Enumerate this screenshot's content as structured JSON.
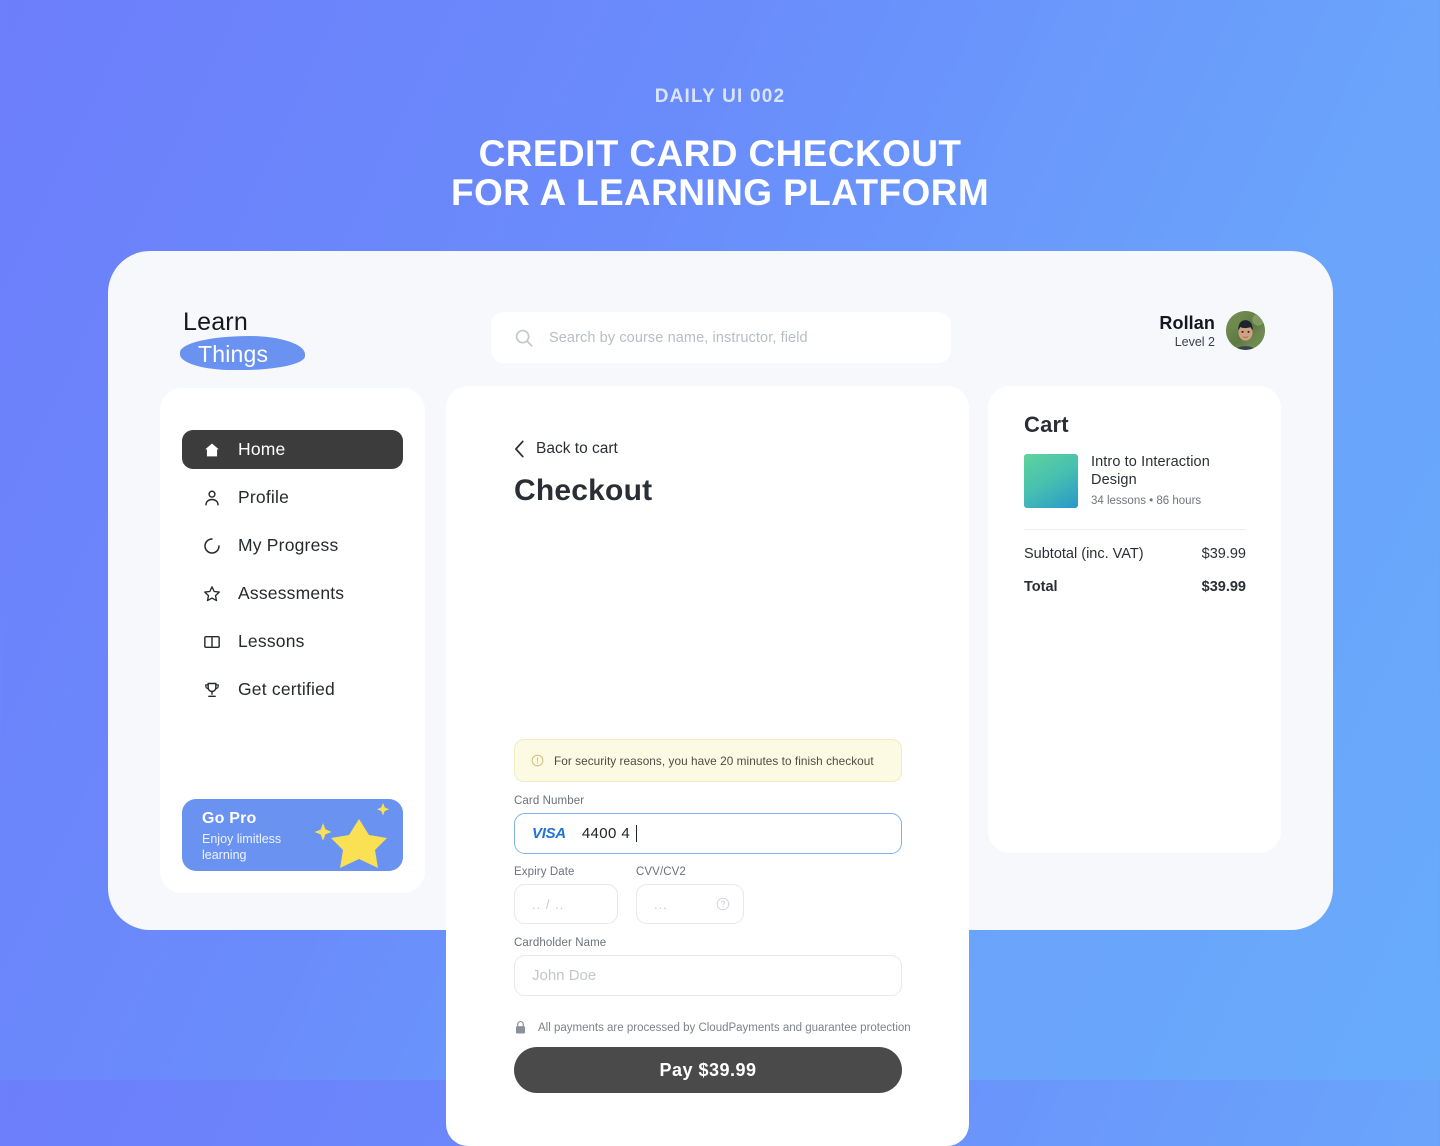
{
  "header": {
    "eyebrow": "DAILY UI 002",
    "title_line1": "CREDIT CARD CHECKOUT",
    "title_line2": "FOR A LEARNING PLATFORM"
  },
  "topbar": {
    "logo_line1": "Learn",
    "logo_line2": "Things",
    "search": {
      "placeholder": "Search by course name, instructor, field",
      "value": ""
    },
    "user": {
      "name": "Rollan",
      "level": "Level 2"
    }
  },
  "sidebar": {
    "items": [
      {
        "label": "Home",
        "icon": "home-icon",
        "active": true
      },
      {
        "label": "Profile",
        "icon": "person-icon",
        "active": false
      },
      {
        "label": "My Progress",
        "icon": "progress-icon",
        "active": false
      },
      {
        "label": "Assessments",
        "icon": "star-icon",
        "active": false
      },
      {
        "label": "Lessons",
        "icon": "book-icon",
        "active": false
      },
      {
        "label": "Get certified",
        "icon": "trophy-icon",
        "active": false
      }
    ],
    "promo": {
      "title": "Go Pro",
      "subtitle": "Enjoy limitless learning"
    }
  },
  "checkout": {
    "back_label": "Back to cart",
    "title": "Checkout",
    "notice": "For security reasons, you have 20 minutes to finish checkout",
    "fields": {
      "card_number_label": "Card Number",
      "card_number_value": "4400 4",
      "card_brand": "VISA",
      "expiry_label": "Expiry Date",
      "expiry_placeholder": ".. / ..",
      "cvv_label": "CVV/CV2",
      "cvv_placeholder": "...",
      "name_label": "Cardholder Name",
      "name_placeholder": "John Doe",
      "name_value": ""
    },
    "secure_note": "All payments are processed by CloudPayments and guarantee protection",
    "pay_label": "Pay $39.99"
  },
  "cart": {
    "title": "Cart",
    "item": {
      "name": "Intro to Interaction Design",
      "meta": "34 lessons • 86 hours"
    },
    "subtotal_label": "Subtotal (inc. VAT)",
    "subtotal_value": "$39.99",
    "total_label": "Total",
    "total_value": "$39.99"
  },
  "colors": {
    "brand_blue": "#6a92f0",
    "dark": "#3c3c3c",
    "notice_bg": "#fcfae3",
    "visa_blue": "#2173d6",
    "star_yellow": "#fae053"
  }
}
